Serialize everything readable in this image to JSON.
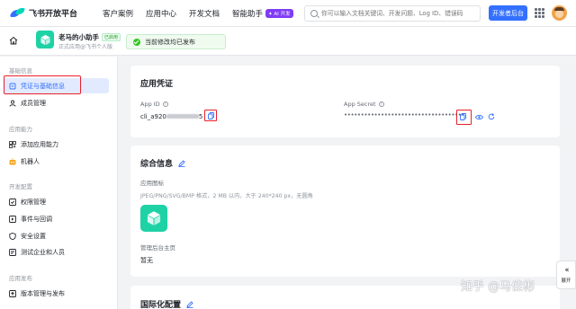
{
  "topbar": {
    "logo_text": "飞书开放平台",
    "nav": [
      "客户案例",
      "应用中心",
      "开发文档",
      "智能助手"
    ],
    "ai_badge": "✦ AI 开发",
    "search_placeholder": "你可以输入文档关键词、开发问题、Log ID、错误码",
    "dev_console_label": "开发者后台"
  },
  "app": {
    "name": "老马的小助手",
    "status": "已启用",
    "subtitle": "正式应用@飞书个人版",
    "saved_message": "当前修改均已发布"
  },
  "sidebar": {
    "sections": [
      {
        "title": "基础信息",
        "items": [
          "凭证与基础信息",
          "成员管理"
        ]
      },
      {
        "title": "应用能力",
        "items": [
          "添加应用能力",
          "机器人"
        ]
      },
      {
        "title": "开发配置",
        "items": [
          "权限管理",
          "事件与回调",
          "安全设置",
          "测试企业和人员"
        ]
      },
      {
        "title": "应用发布",
        "items": [
          "版本管理与发布"
        ]
      }
    ],
    "active_item": "凭证与基础信息"
  },
  "credentials": {
    "title": "应用凭证",
    "app_id_label": "App ID",
    "app_id_prefix": "cli_a920",
    "app_id_suffix": "5",
    "app_secret_label": "App Secret",
    "app_secret_masked": "••••••••••••••••••••••••••••••••••••"
  },
  "general_info": {
    "title": "综合信息",
    "icon_label": "应用图标",
    "icon_hint": "JPEG/PNG/SVG/BMP 格式，2 MB 以内，大于 240*240 px，无圆角",
    "admin_home_label": "管理后台主页",
    "admin_home_value": "暂无"
  },
  "i18n": {
    "title": "国际化配置"
  },
  "float_panel": {
    "chevron": "‹‹",
    "label": "展开"
  },
  "watermark": "知乎 @马佳彬",
  "colors": {
    "accent": "#3370ff",
    "app_icon": "#1ed2a6",
    "highlight": "#e8212c",
    "success": "#34c724"
  }
}
